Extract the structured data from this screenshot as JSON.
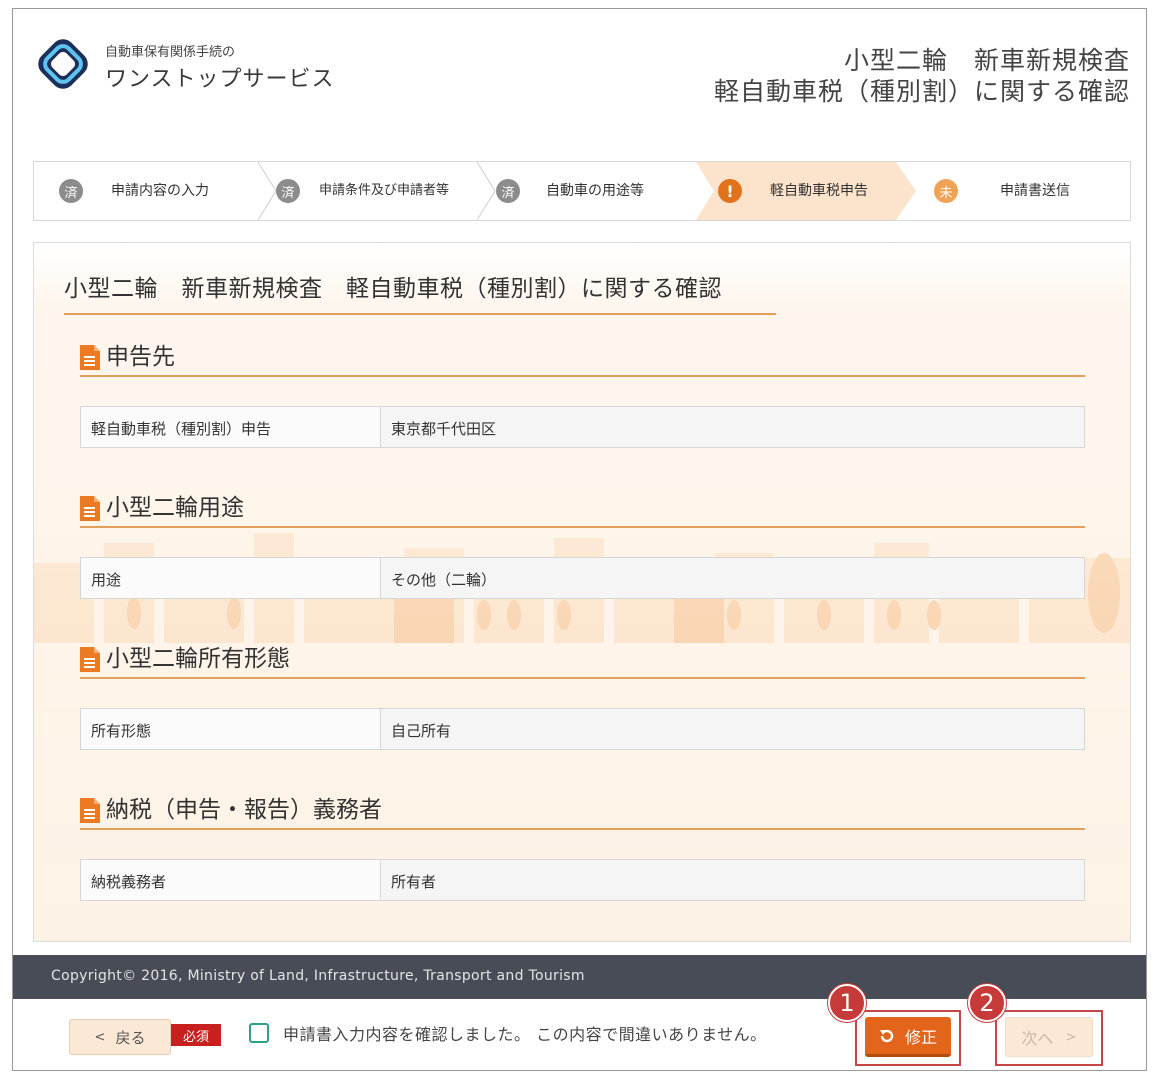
{
  "brand": {
    "subtitle": "自動車保有関係手続の",
    "name": "ワンストップサービス"
  },
  "page_title": {
    "line1": "小型二輪　新車新規検査",
    "line2": "軽自動車税（種別割）に関する確認"
  },
  "steps": [
    {
      "badge": "済",
      "label": "申請内容の入力",
      "status": "done"
    },
    {
      "badge": "済",
      "label": "申請条件及び申請者等",
      "status": "done"
    },
    {
      "badge": "済",
      "label": "自動車の用途等",
      "status": "done"
    },
    {
      "badge": "!",
      "label": "軽自動車税申告",
      "status": "current"
    },
    {
      "badge": "未",
      "label": "申請書送信",
      "status": "todo"
    }
  ],
  "main": {
    "title": "小型二輪　新車新規検査　軽自動車税（種別割）に関する確認",
    "sections": [
      {
        "heading": "申告先",
        "key": "軽自動車税（種別割）申告",
        "value": "東京都千代田区"
      },
      {
        "heading": "小型二輪用途",
        "key": "用途",
        "value": "その他（二輪）"
      },
      {
        "heading": "小型二輪所有形態",
        "key": "所有形態",
        "value": "自己所有"
      },
      {
        "heading": "納税（申告・報告）義務者",
        "key": "納税義務者",
        "value": "所有者"
      }
    ]
  },
  "footer": {
    "copyright": "Copyright© 2016, Ministry of Land, Infrastructure, Transport and Tourism",
    "back_label": "戻る",
    "required_label": "必須",
    "confirm_text": "申請書入力内容を確認しました。 この内容で間違いありません。",
    "fix_label": "修正",
    "next_label": "次へ",
    "callout_1": "1",
    "callout_2": "2"
  },
  "colors": {
    "accent": "#e2651b",
    "highlight": "#c94646",
    "footer_bar": "#474c57"
  }
}
